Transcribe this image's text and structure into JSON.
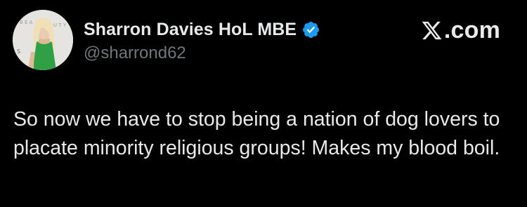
{
  "author": {
    "display_name": "Sharron Davies HoL MBE",
    "handle": "@sharrond62",
    "verified": true,
    "avatar_icon": "profile-photo"
  },
  "brand": {
    "label": ".com",
    "logo_icon": "x-logo-icon"
  },
  "tweet": {
    "text": "So now we have to stop being a nation of dog lovers to placate minority religious groups! Makes my blood boil."
  },
  "colors": {
    "background": "#000000",
    "primary_text": "#e7e9ea",
    "secondary_text": "#71767b",
    "verified_badge": "#1d9bf0"
  }
}
